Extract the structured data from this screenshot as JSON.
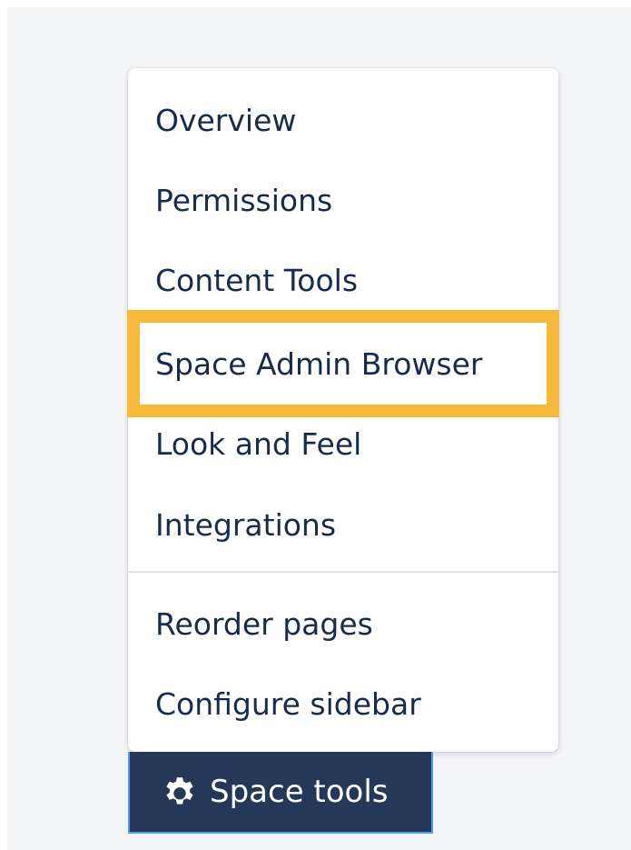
{
  "colors": {
    "page_background": "#f4f5f7",
    "menu_text": "#172b4d",
    "highlight_outline": "#f6b93b",
    "button_background": "#253858",
    "button_text": "#ffffff"
  },
  "menu": {
    "items": [
      {
        "label": "Overview"
      },
      {
        "label": "Permissions"
      },
      {
        "label": "Content Tools"
      },
      {
        "label": "Space Admin Browser",
        "highlighted": true
      },
      {
        "label": "Look and Feel"
      },
      {
        "label": "Integrations"
      },
      {
        "label": "Reorder pages"
      },
      {
        "label": "Configure sidebar"
      }
    ]
  },
  "space_tools_button": {
    "icon": "gear-icon",
    "label": "Space tools"
  }
}
